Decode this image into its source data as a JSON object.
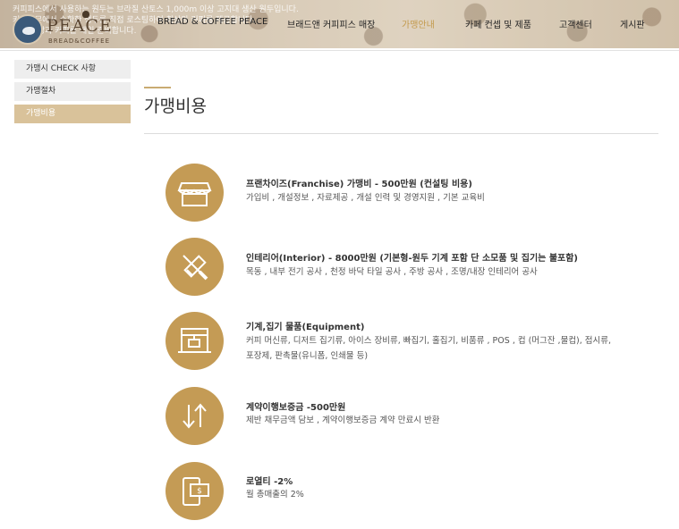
{
  "header": {
    "notice_lines": [
      "커피피스에서 사용하는 원두는 브라질 산토스 1,000m 이상 고지대 생산 원두입니다.",
      "커피나무에서 수확한 생두를 직접 로스팅하여 최상의 커피를 제공합니다.",
      "신선한 빵과 커피를 매일 준비합니다."
    ],
    "logo": {
      "name": "PEACE",
      "sub": "BREAD&COFFEE"
    },
    "nav": [
      {
        "label": "BREAD & COFFEE PEACE",
        "active": false
      },
      {
        "label": "브래드앤 커피피스 매장",
        "active": false
      },
      {
        "label": "가맹안내",
        "active": true
      },
      {
        "label": "카페 컨셉 및 제품",
        "active": false
      },
      {
        "label": "고객센터",
        "active": false
      },
      {
        "label": "게시판",
        "active": false
      }
    ]
  },
  "sidebar": {
    "items": [
      {
        "label": "가맹시 CHECK 사항",
        "active": false
      },
      {
        "label": "가맹절차",
        "active": false
      },
      {
        "label": "가맹비용",
        "active": true
      }
    ]
  },
  "page": {
    "title": "가맹비용"
  },
  "items": [
    {
      "icon": "storefront-icon",
      "title": "프랜차이즈(Franchise) 가맹비 - 500만원 (컨설팅 비용)",
      "desc": [
        "가입비 , 개설정보 , 자료제공 , 개설 인력 및 경영지원 , 기본 교육비"
      ]
    },
    {
      "icon": "tools-icon",
      "title": "인테리어(Interior) - 8000만원 (기본형-원두 기계 포함 단 소모품 및 집기는 불포함)",
      "desc": [
        "목동 , 내부 전기 공사 , 천정 바닥 타일 공사 , 주방 공사 , 조명/내장 인테리어 공사"
      ]
    },
    {
      "icon": "coffee-machine-icon",
      "title": "기계,집기 물품(Equipment)",
      "desc": [
        "커피 머신류, 디저트 집기류, 아이스 장비류, 빠집기, 홀집기, 비품류 , POS , 컵 (머그잔 ,물컵), 접시류,",
        "포장제, 판촉물(유니폼, 인쇄물 등)"
      ]
    },
    {
      "icon": "up-down-arrows-icon",
      "title": "계약이행보증금 -500만원",
      "desc": [
        "제반 채무금액 담보 , 계약이행보증금 계약 만료시 반환"
      ]
    },
    {
      "icon": "mobile-payment-icon",
      "title": "로열티 -2%",
      "desc": [
        "월 총매출의 2%"
      ]
    }
  ],
  "colors": {
    "accent": "#c49b55",
    "sidebar_active": "#d9c29a",
    "nav_active": "#c39a4c"
  }
}
